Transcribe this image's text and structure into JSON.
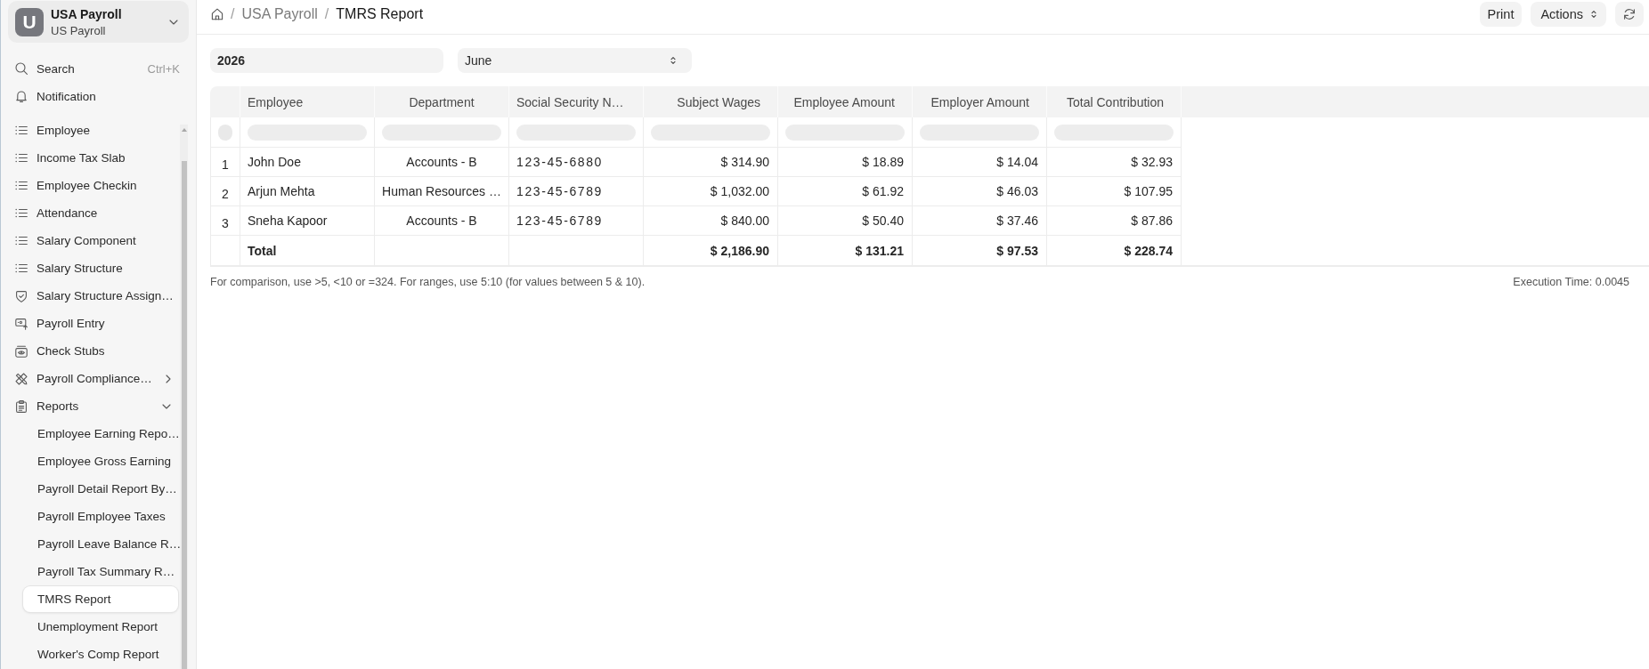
{
  "workspace": {
    "initial": "U",
    "name": "USA Payroll",
    "subtitle": "US Payroll"
  },
  "sidebar": {
    "search": {
      "label": "Search",
      "shortcut": "Ctrl+K"
    },
    "notification": {
      "label": "Notification"
    },
    "items": [
      {
        "kind": "list",
        "label": "Employee",
        "selected": false
      },
      {
        "kind": "list",
        "label": "Income Tax Slab",
        "selected": false
      },
      {
        "kind": "list",
        "label": "Employee Checkin",
        "selected": false
      },
      {
        "kind": "list",
        "label": "Attendance",
        "selected": false
      },
      {
        "kind": "list",
        "label": "Salary Component",
        "selected": false
      },
      {
        "kind": "list",
        "label": "Salary Structure",
        "selected": false
      },
      {
        "kind": "assignment",
        "label": "Salary Structure Assign…",
        "selected": false
      },
      {
        "kind": "entry",
        "label": "Payroll Entry",
        "selected": false
      },
      {
        "kind": "stubs",
        "label": "Check Stubs",
        "selected": false
      },
      {
        "kind": "compliance",
        "label": "Payroll Compliance…",
        "selected": false,
        "expanded": false
      },
      {
        "kind": "reports",
        "label": "Reports",
        "selected": false,
        "expanded": true,
        "children": [
          {
            "label": "Employee Earning Repo…",
            "selected": false
          },
          {
            "label": "Employee Gross Earning",
            "selected": false
          },
          {
            "label": "Payroll Detail Report By…",
            "selected": false
          },
          {
            "label": "Payroll Employee Taxes",
            "selected": false
          },
          {
            "label": "Payroll Leave Balance R…",
            "selected": false
          },
          {
            "label": "Payroll Tax Summary R…",
            "selected": false
          },
          {
            "label": "TMRS Report",
            "selected": true
          },
          {
            "label": "Unemployment Report",
            "selected": false
          },
          {
            "label": "Worker's Comp Report",
            "selected": false
          }
        ]
      }
    ]
  },
  "breadcrumbs": {
    "separator": "/",
    "items": [
      {
        "label": "USA Payroll",
        "current": false
      },
      {
        "label": "TMRS Report",
        "current": true
      }
    ]
  },
  "toolbar": [
    {
      "kind": "print",
      "label": "Print"
    },
    {
      "kind": "menu",
      "label": "Actions"
    },
    {
      "kind": "refresh"
    }
  ],
  "filters": [
    {
      "kind": "input",
      "value": "2026"
    },
    {
      "kind": "select",
      "value": "June"
    }
  ],
  "table": {
    "columns": [
      {
        "label": "Employee",
        "kind": "text"
      },
      {
        "label": "Department",
        "kind": "category"
      },
      {
        "label": "Social Security N…",
        "kind": "id"
      },
      {
        "label": "Subject Wages",
        "kind": "currency"
      },
      {
        "label": "Employee Amount",
        "kind": "currency"
      },
      {
        "label": "Employer Amount",
        "kind": "currency"
      },
      {
        "label": "Total Contribution",
        "kind": "currency"
      }
    ],
    "rows": [
      {
        "index": "1",
        "cells": [
          "John Doe",
          "Accounts - B",
          "123-45-6880",
          "$ 314.90",
          "$ 18.89",
          "$ 14.04",
          "$ 32.93"
        ]
      },
      {
        "index": "2",
        "cells": [
          "Arjun Mehta",
          "Human Resources …",
          "123-45-6789",
          "$ 1,032.00",
          "$ 61.92",
          "$ 46.03",
          "$ 107.95"
        ]
      },
      {
        "index": "3",
        "cells": [
          "Sneha Kapoor",
          "Accounts - B",
          "123-45-6789",
          "$ 840.00",
          "$ 50.40",
          "$ 37.46",
          "$ 87.86"
        ]
      }
    ],
    "total": {
      "label": "Total",
      "values": [
        "$ 2,186.90",
        "$ 131.21",
        "$ 97.53",
        "$ 228.74"
      ]
    }
  },
  "footer": {
    "hint": "For comparison, use >5, <10 or =324. For ranges, use 5:10 (for values between 5 & 10).",
    "execution_time": "Execution Time: 0.0045"
  }
}
